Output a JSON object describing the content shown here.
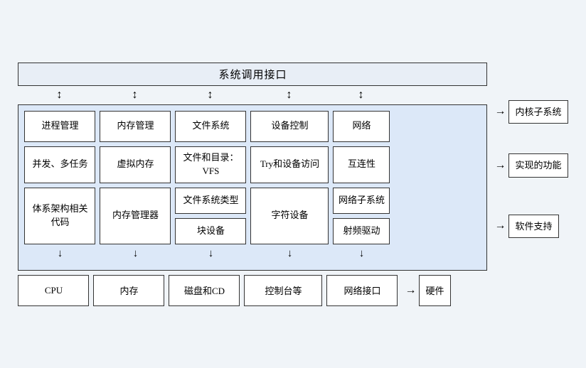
{
  "diagram": {
    "title": "系统调用接口",
    "row1": {
      "cells": [
        "进程管理",
        "内存管理",
        "文件系统",
        "设备控制",
        "网络"
      ]
    },
    "row2": {
      "cells": [
        "并发、多任务",
        "虚拟内存",
        "文件和目录：VFS",
        "Try和设备访问",
        "互连性"
      ]
    },
    "row3": {
      "left": [
        "体系架构相关代码",
        "内存管理器"
      ],
      "mid_top": "文件系统类型",
      "mid_bot": "块设备",
      "center": "字符设备",
      "right_top": "网络子系统",
      "right_bot": "射频驱动"
    },
    "bottom": {
      "cells": [
        "CPU",
        "内存",
        "磁盘和CD",
        "控制台等",
        "网络接口"
      ]
    },
    "right_labels": [
      "内核子系统",
      "实现的功能",
      "软件支持"
    ],
    "hardware": "硬件"
  }
}
